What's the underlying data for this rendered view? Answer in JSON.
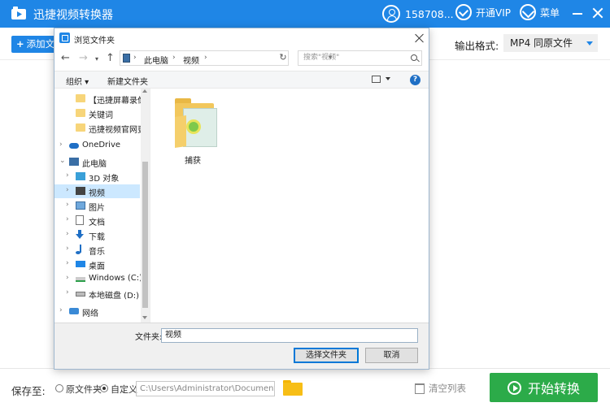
{
  "app": {
    "title": "迅捷视频转换器",
    "user_name": "158708...",
    "vip_label": "开通VIP",
    "menu_label": "菜单"
  },
  "toolbar": {
    "add_file_label": "添加文",
    "format_label": "输出格式:",
    "format_value": "MP4  同原文件"
  },
  "bottom": {
    "save_label": "保存至:",
    "radio_original": "原文件夹",
    "radio_custom": "自定义",
    "custom_selected": true,
    "path": "C:\\Users\\Administrator\\Documents",
    "clear_label": "清空列表",
    "start_label": "开始转换"
  },
  "dialog": {
    "title": "浏览文件夹",
    "address": [
      "此电脑",
      "视频"
    ],
    "search_placeholder": "搜索\"视频\"",
    "organize_label": "组织 ▾",
    "new_folder_label": "新建文件夹",
    "help_label": "?",
    "tree": [
      {
        "label": "【迅捷屏幕录像",
        "icon": "folder-icon",
        "indent": 1,
        "expand": false
      },
      {
        "label": "关键词",
        "icon": "folder-icon",
        "indent": 1,
        "expand": false
      },
      {
        "label": "迅捷视频官网更新",
        "icon": "folder-icon",
        "indent": 1,
        "expand": false
      },
      {
        "label": "OneDrive",
        "icon": "onedrive-icon",
        "indent": 0,
        "expand": true
      },
      {
        "label": "此电脑",
        "icon": "pc-icon",
        "indent": 0,
        "expand": true,
        "open": true
      },
      {
        "label": "3D 对象",
        "icon": "3d-objects-icon",
        "indent": 1,
        "expand": true
      },
      {
        "label": "视频",
        "icon": "video-icon",
        "indent": 1,
        "expand": true,
        "selected": true
      },
      {
        "label": "图片",
        "icon": "pictures-icon",
        "indent": 1,
        "expand": true
      },
      {
        "label": "文档",
        "icon": "documents-icon",
        "indent": 1,
        "expand": true
      },
      {
        "label": "下载",
        "icon": "downloads-icon",
        "indent": 1,
        "expand": true
      },
      {
        "label": "音乐",
        "icon": "music-icon",
        "indent": 1,
        "expand": true
      },
      {
        "label": "桌面",
        "icon": "desktop-icon",
        "indent": 1,
        "expand": true
      },
      {
        "label": "Windows (C:)",
        "icon": "drive-c-icon",
        "indent": 1,
        "expand": true
      },
      {
        "label": "本地磁盘 (D:)",
        "icon": "drive-d-icon",
        "indent": 1,
        "expand": true
      },
      {
        "label": "网络",
        "icon": "network-icon",
        "indent": 0,
        "expand": true
      }
    ],
    "content_folder": "捕获",
    "folder_field_label": "文件夹:",
    "folder_field_value": "视频",
    "select_button": "选择文件夹",
    "cancel_button": "取消"
  },
  "colors": {
    "brand_blue": "#1f86e6",
    "start_green": "#2cab49",
    "selected_row": "#cce8ff"
  }
}
